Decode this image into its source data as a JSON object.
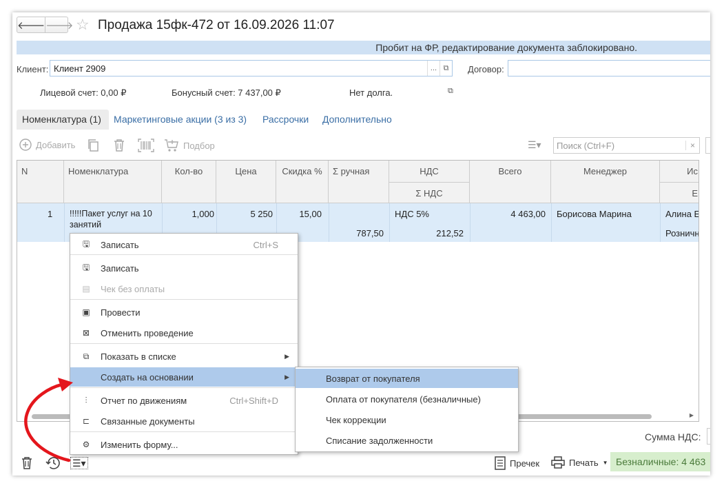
{
  "header": {
    "title": "Продажа 15фк-472 от 16.09.2026 11:07",
    "back_icon": "arrow-left",
    "forward_icon": "arrow-right",
    "star_icon": "star"
  },
  "banner": "Пробит на ФР, редактирование документа заблокировано.",
  "client": {
    "label": "Клиент:",
    "value": "Клиент 2909",
    "select_glyph": "...",
    "open_glyph": "⧉"
  },
  "contract": {
    "label": "Договор:",
    "value": ""
  },
  "info": {
    "personal_account": "Лицевой счет: 0,00 ₽",
    "bonus_account": "Бонусный счет: 7 437,00 ₽",
    "debt": "Нет долга."
  },
  "tabs": [
    {
      "label": "Номенклатура (1)",
      "active": true
    },
    {
      "label": "Маркетинговые акции (3 из 3)"
    },
    {
      "label": "Рассрочки"
    },
    {
      "label": "Дополнительно"
    }
  ],
  "toolbar": {
    "add_label": "Добавить",
    "pick_label": "Подбор",
    "search_placeholder": "Поиск (Ctrl+F)",
    "search_clear": "×"
  },
  "table": {
    "columns": [
      "N",
      "Номенклатура",
      "Кол-во",
      "Цена",
      "Скидка %",
      "Σ ручная",
      "НДС",
      "Всего",
      "Менеджер",
      "Ис"
    ],
    "subheaders": {
      "nds_sum": "Σ НДС",
      "extra": "Е"
    },
    "rows": [
      {
        "n": "1",
        "item_line1": "!!!!!Пакет услуг на 10",
        "item_line2": "занятий",
        "qty": "1,000",
        "price": "5 250",
        "discount": "15,00",
        "manual_sum": "787,50",
        "nds": "НДС 5%",
        "nds_sum": "212,52",
        "total": "4 463,00",
        "manager": "Борисова Марина",
        "extra1": "Алина Е",
        "extra2": "Розничн"
      }
    ]
  },
  "context_menu": {
    "items": [
      {
        "label": "Записать",
        "shortcut": "Ctrl+S",
        "icon": "save-icon"
      },
      {
        "label": "Записать",
        "icon": "save-icon"
      },
      {
        "label": "Чек без оплаты",
        "icon": "receipt-icon",
        "disabled": true
      },
      {
        "label": "Провести",
        "icon": "post-icon"
      },
      {
        "label": "Отменить проведение",
        "icon": "unpost-icon"
      },
      {
        "label": "Показать в списке",
        "icon": "list-icon",
        "submenu": true
      },
      {
        "label": "Создать на основании",
        "icon": "",
        "submenu": true,
        "highlighted": true
      },
      {
        "label": "Отчет по движениям",
        "shortcut": "Ctrl+Shift+D",
        "icon": "movements-icon"
      },
      {
        "label": "Связанные документы",
        "icon": "related-docs-icon"
      },
      {
        "label": "Изменить форму...",
        "icon": "settings-icon"
      }
    ]
  },
  "submenu": {
    "items": [
      {
        "label": "Возврат от покупателя",
        "highlighted": true
      },
      {
        "label": "Оплата от покупателя (безналичные)"
      },
      {
        "label": "Чек коррекции"
      },
      {
        "label": "Списание задолженности"
      }
    ]
  },
  "footer": {
    "nds_sum_label": "Сумма НДС:",
    "precheck_label": "Пречек",
    "print_label": "Печать",
    "cashless": "Безналичные: 4 463"
  },
  "colors": {
    "accent": "#3a6ea5",
    "highlight": "#aecaeb",
    "row_selected": "#dcebf9",
    "cashless_bg": "#d7eecd",
    "arrow": "#e4161c"
  }
}
